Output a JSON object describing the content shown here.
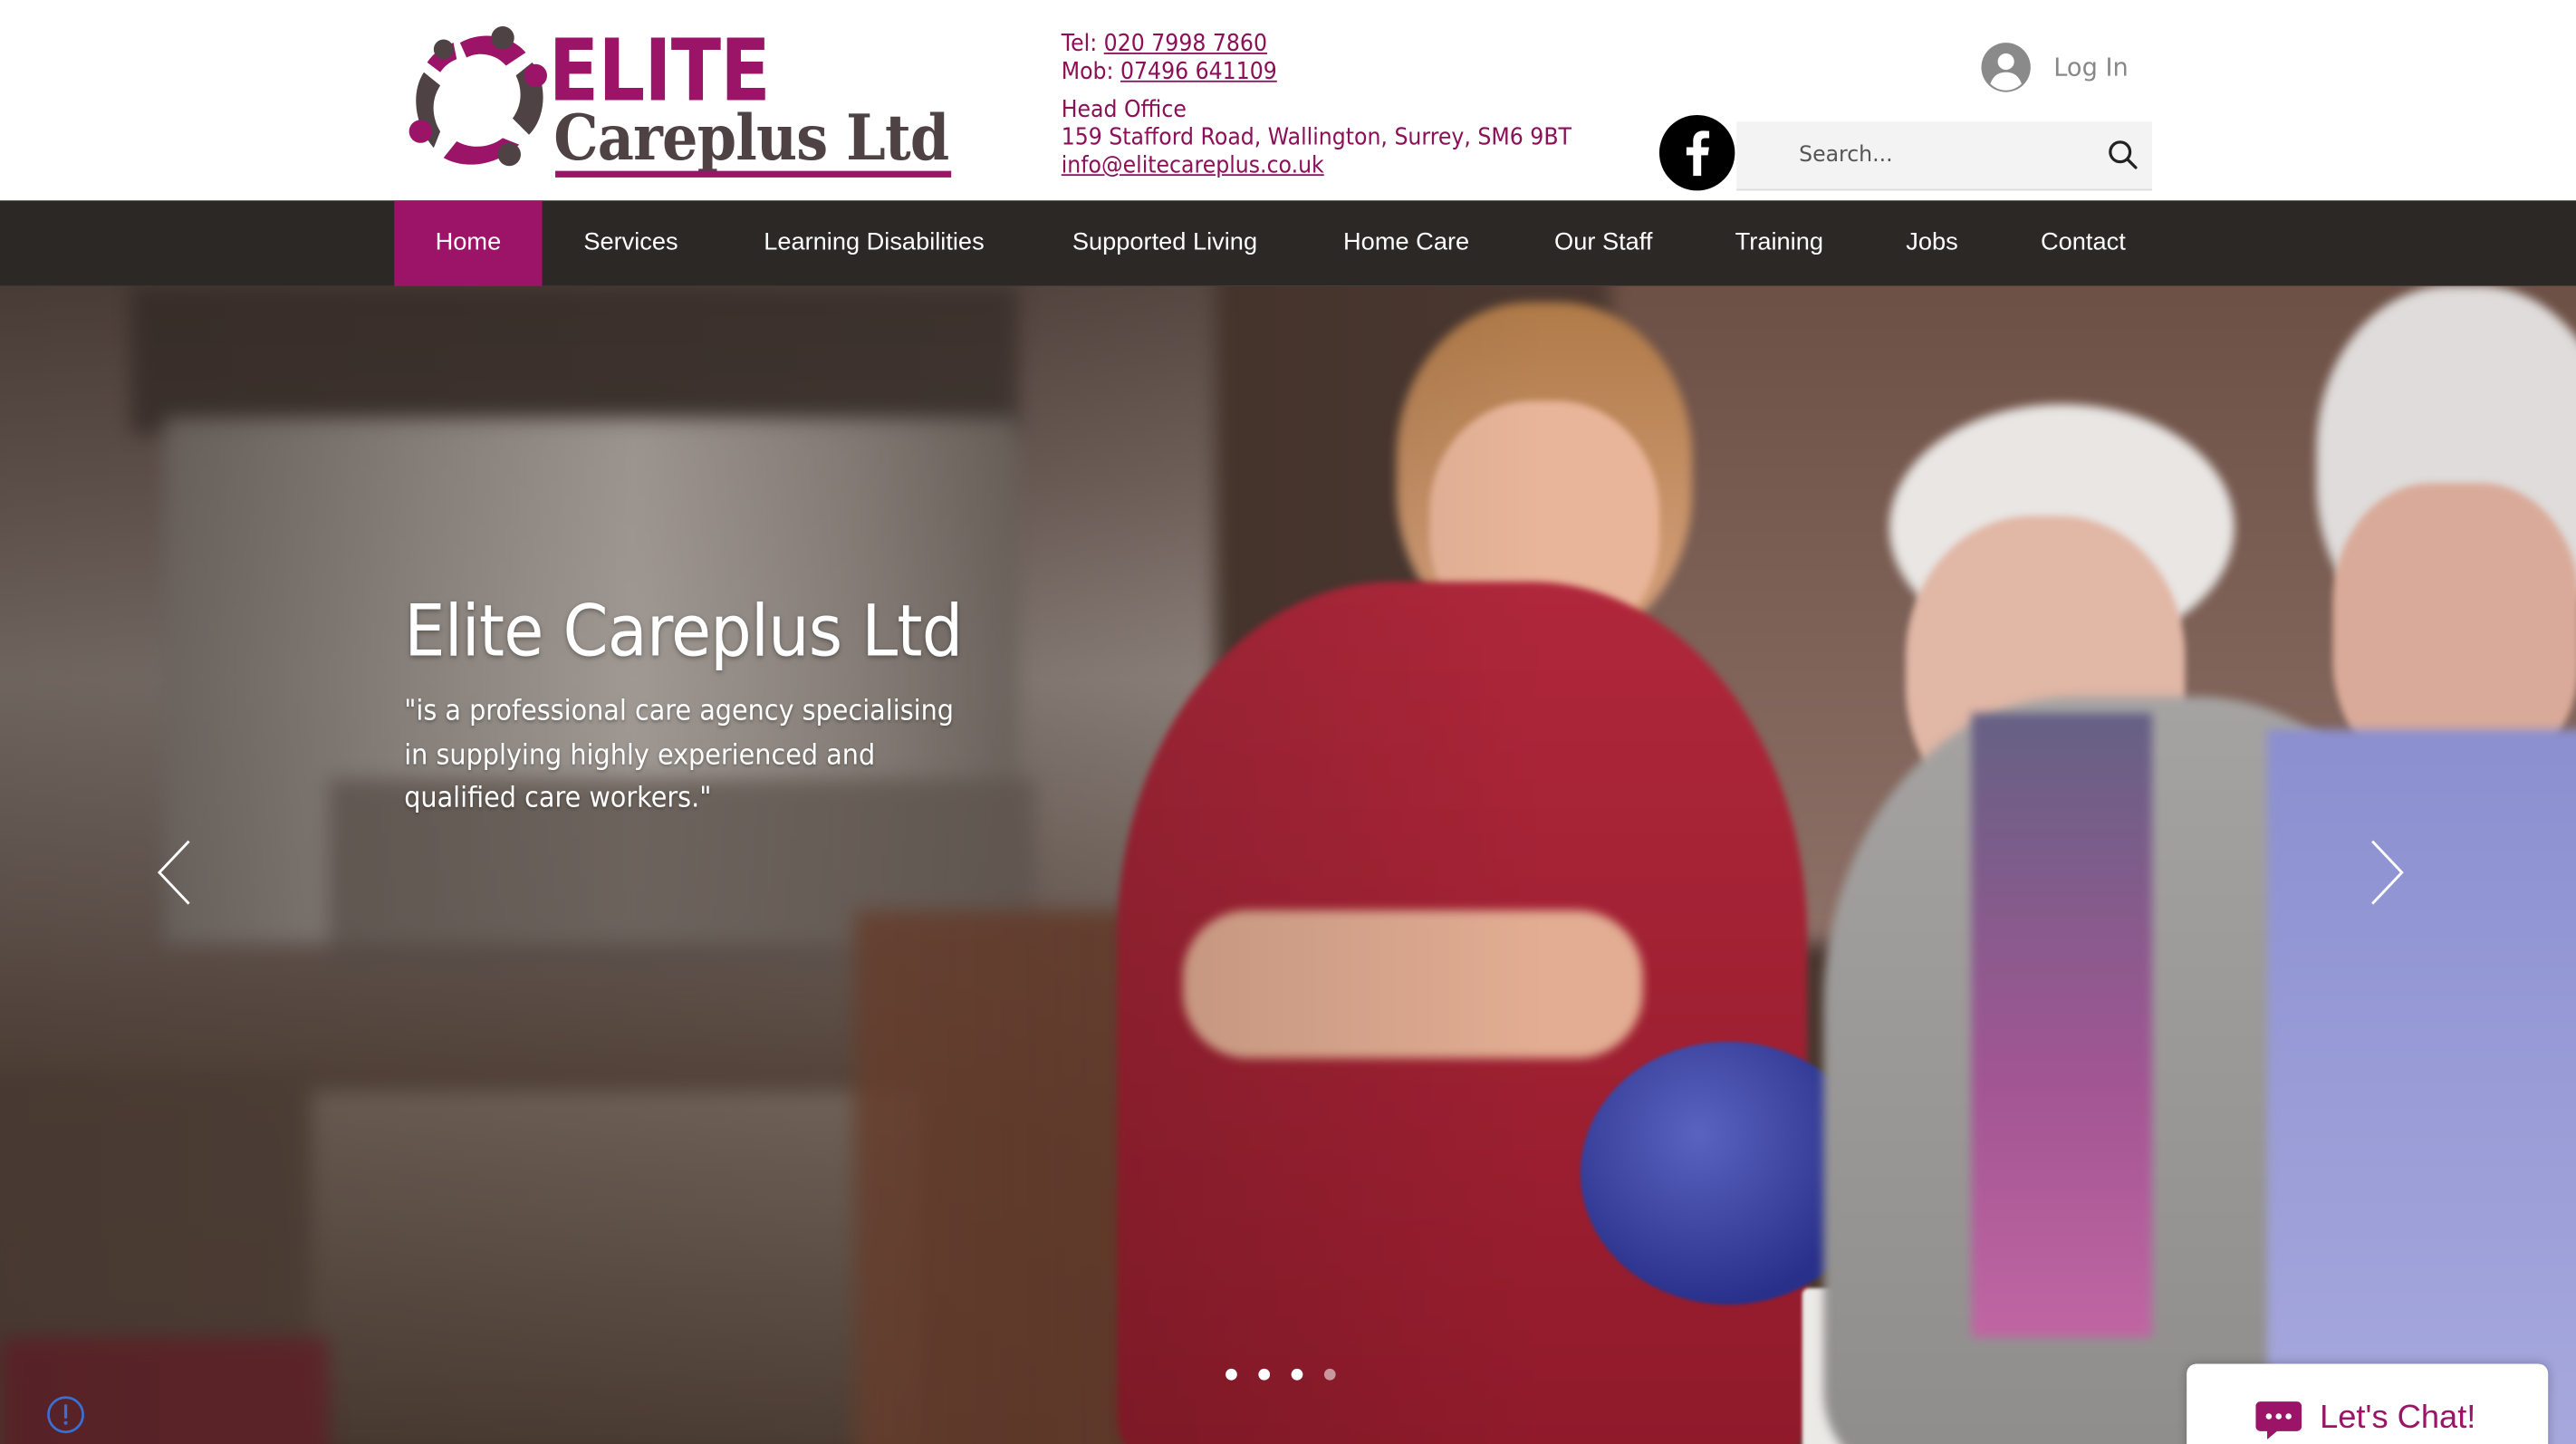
{
  "header": {
    "logo": {
      "word_top": "ELITE",
      "word_bottom": "Careplus Ltd"
    },
    "contact": {
      "tel_label": "Tel: ",
      "tel": "020 7998 7860",
      "mob_label": "Mob: ",
      "mob": "07496 641109",
      "office_label": "Head Office",
      "address": "159 Stafford Road, Wallington, Surrey, SM6 9BT",
      "email": "info@elitecareplus.co.uk"
    },
    "search": {
      "placeholder": "Search..."
    },
    "login_label": "Log In"
  },
  "nav": {
    "items": [
      {
        "label": "Home",
        "active": true
      },
      {
        "label": "Services"
      },
      {
        "label": "Learning Disabilities"
      },
      {
        "label": "Supported Living"
      },
      {
        "label": "Home Care"
      },
      {
        "label": "Our Staff"
      },
      {
        "label": "Training"
      },
      {
        "label": "Jobs"
      },
      {
        "label": "Contact"
      }
    ]
  },
  "hero": {
    "title": "Elite Careplus Ltd",
    "quote": "\"is a professional care agency specialising in supplying highly experienced and qualified care workers.\"",
    "slides_total": 4,
    "slide_current": 4
  },
  "chat": {
    "label": "Let's Chat!"
  },
  "colors": {
    "brand": "#9b1468",
    "nav_bg": "#2b2826",
    "text_contact": "#8b1058"
  },
  "icons": [
    "facebook-icon",
    "search-icon",
    "avatar-icon",
    "chevron-left-icon",
    "chevron-right-icon",
    "chat-bubble-icon",
    "info-icon"
  ]
}
